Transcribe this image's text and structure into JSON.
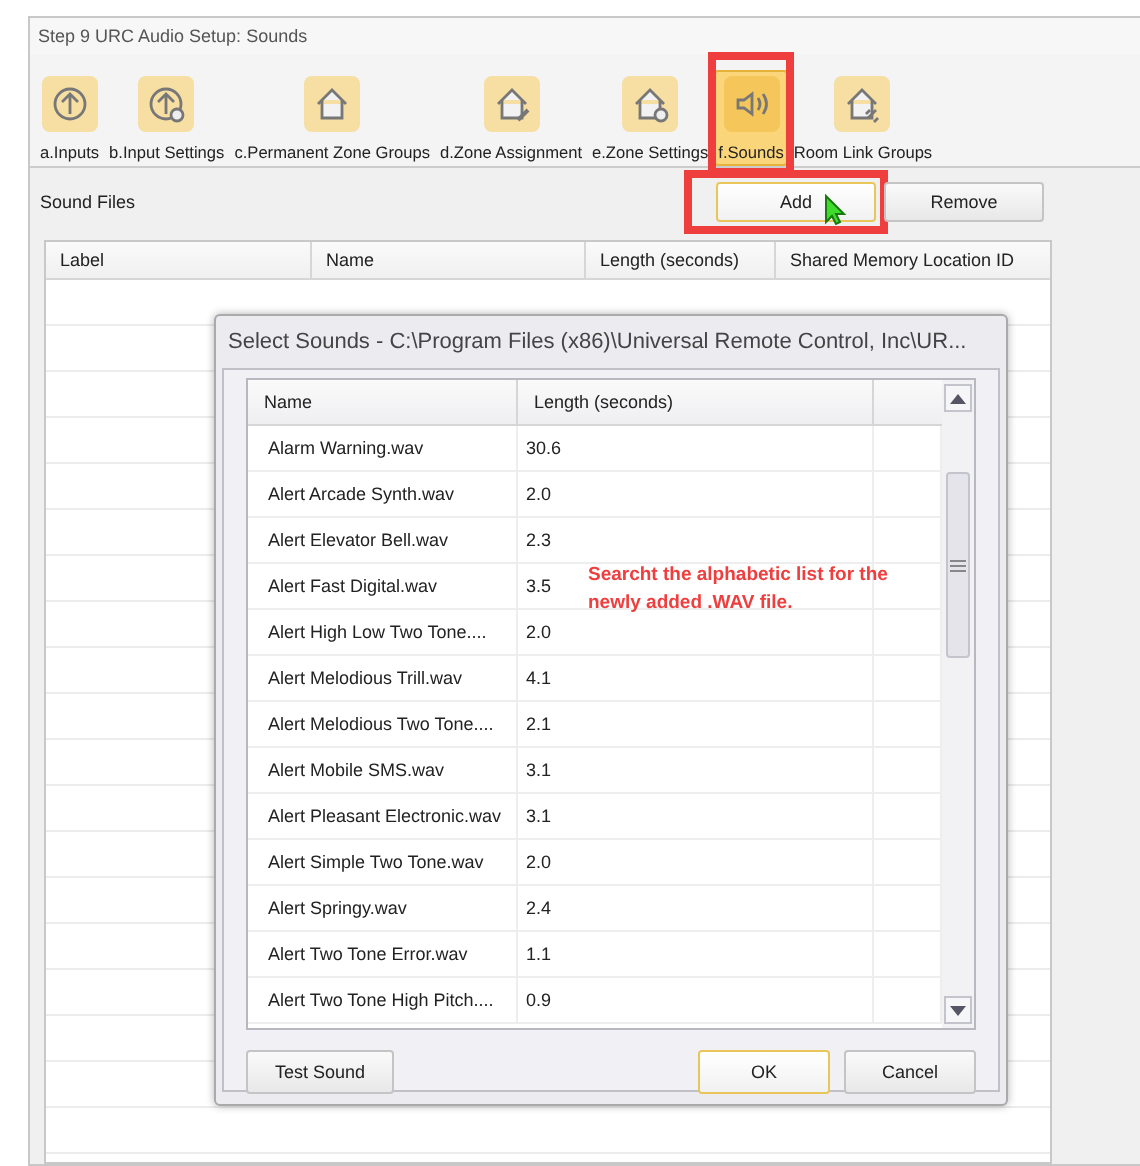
{
  "window": {
    "title": "Step 9 URC Audio Setup: Sounds"
  },
  "tabs": [
    {
      "label": "a.Inputs",
      "selected": false,
      "highlighted": false
    },
    {
      "label": "b.Input Settings",
      "selected": false,
      "highlighted": false
    },
    {
      "label": "c.Permanent Zone Groups",
      "selected": false,
      "highlighted": false
    },
    {
      "label": "d.Zone Assignment",
      "selected": false,
      "highlighted": false
    },
    {
      "label": "e.Zone Settings",
      "selected": false,
      "highlighted": false
    },
    {
      "label": "f.Sounds",
      "selected": true,
      "highlighted": true
    },
    {
      "label": "Room Link Groups",
      "selected": false,
      "highlighted": false
    }
  ],
  "section_label": "Sound Files",
  "buttons": [
    {
      "label": "Add",
      "focused": true,
      "highlighted": true
    },
    {
      "label": "Remove",
      "focused": false,
      "highlighted": false
    }
  ],
  "table": {
    "columns": [
      "Label",
      "Name",
      "Length (seconds)",
      "Shared Memory Location ID"
    ]
  },
  "dialog": {
    "title": "Select Sounds - C:\\Program Files (x86)\\Universal Remote Control, Inc\\UR...",
    "columns": [
      "Name",
      "Length (seconds)"
    ],
    "rows": [
      [
        "Alarm Warning.wav",
        "30.6"
      ],
      [
        "Alert Arcade Synth.wav",
        "2.0"
      ],
      [
        "Alert Elevator Bell.wav",
        "2.3"
      ],
      [
        "Alert Fast Digital.wav",
        "3.5"
      ],
      [
        "Alert High Low Two Tone....",
        "2.0"
      ],
      [
        "Alert Melodious Trill.wav",
        "4.1"
      ],
      [
        "Alert Melodious Two Tone....",
        "2.1"
      ],
      [
        "Alert Mobile SMS.wav",
        "3.1"
      ],
      [
        "Alert Pleasant Electronic.wav",
        "3.1"
      ],
      [
        "Alert Simple Two Tone.wav",
        "2.0"
      ],
      [
        "Alert Springy.wav",
        "2.4"
      ],
      [
        "Alert Two Tone Error.wav",
        "1.1"
      ],
      [
        "Alert Two Tone High Pitch....",
        "0.9"
      ]
    ],
    "note": "Searcht the alphabetic list for the newly added .WAV file.",
    "buttons": [
      {
        "label": "Test Sound",
        "focused": false
      },
      {
        "label": "OK",
        "focused": true
      },
      {
        "label": "Cancel",
        "focused": false
      }
    ]
  }
}
